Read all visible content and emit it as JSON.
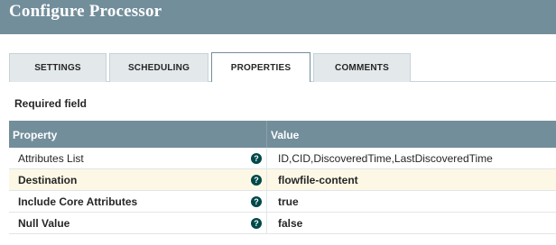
{
  "header": {
    "title": "Configure Processor"
  },
  "tabs": [
    {
      "label": "SETTINGS",
      "active": false
    },
    {
      "label": "SCHEDULING",
      "active": false
    },
    {
      "label": "PROPERTIES",
      "active": true
    },
    {
      "label": "COMMENTS",
      "active": false
    }
  ],
  "required_label": "Required field",
  "grid": {
    "columns": [
      "Property",
      "Value"
    ],
    "help_glyph": "?",
    "rows": [
      {
        "property": "Attributes List",
        "value": "ID,CID,DiscoveredTime,LastDiscoveredTime",
        "required": false,
        "selected": false
      },
      {
        "property": "Destination",
        "value": "flowfile-content",
        "required": true,
        "selected": true
      },
      {
        "property": "Include Core Attributes",
        "value": "true",
        "required": true,
        "selected": false
      },
      {
        "property": "Null Value",
        "value": "false",
        "required": true,
        "selected": false
      }
    ]
  },
  "colors": {
    "header_bg": "#728e9b",
    "tab_bg": "#e3e8eb",
    "selected_row_bg": "#fdf8e6",
    "help_icon_bg": "#004849"
  }
}
